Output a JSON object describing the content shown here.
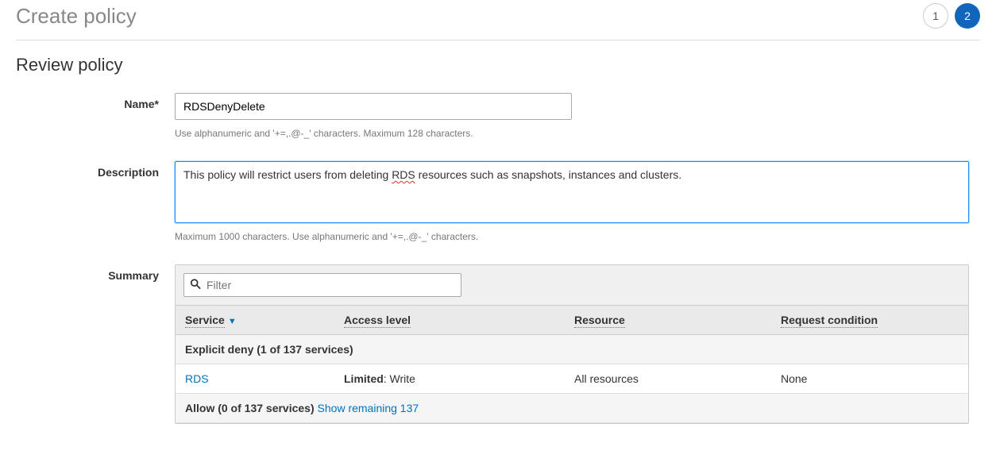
{
  "header": {
    "title": "Create policy",
    "steps": [
      "1",
      "2"
    ],
    "activeStep": 2
  },
  "section": {
    "title": "Review policy"
  },
  "form": {
    "nameLabel": "Name*",
    "nameValue": "RDSDenyDelete",
    "nameHint": "Use alphanumeric and '+=,.@-_' characters. Maximum 128 characters.",
    "descLabel": "Description",
    "descValue1": "This policy will restrict users from deleting ",
    "descSpell": "RDS",
    "descValue2": " resources such as snapshots, instances and clusters.",
    "descHint": "Maximum 1000 characters. Use alphanumeric and '+=,.@-_' characters.",
    "summaryLabel": "Summary"
  },
  "filter": {
    "placeholder": "Filter"
  },
  "table": {
    "headers": {
      "service": "Service",
      "access": "Access level",
      "resource": "Resource",
      "condition": "Request condition"
    },
    "groupDeny": "Explicit deny (1 of 137 services)",
    "row": {
      "service": "RDS",
      "accessBold": "Limited",
      "accessRest": ": Write",
      "resource": "All resources",
      "condition": "None"
    },
    "groupAllow": "Allow (0 of 137 services) ",
    "showRemaining": "Show remaining 137"
  }
}
